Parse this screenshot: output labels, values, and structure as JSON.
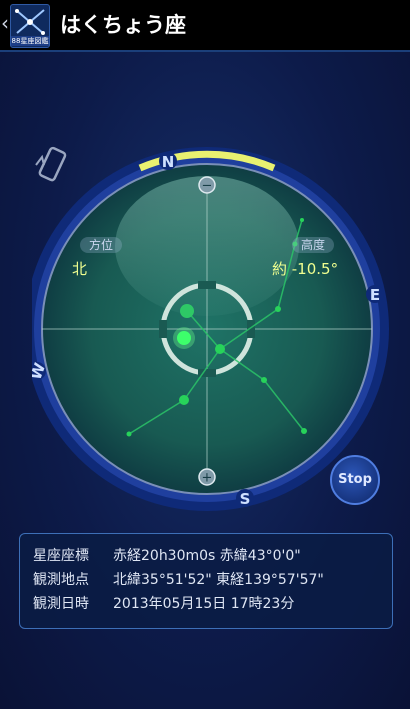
{
  "header": {
    "back_glyph": "‹",
    "logo_text": "88星座図鑑",
    "title": "はくちょう座"
  },
  "compass": {
    "directions": {
      "north": "N",
      "east": "E",
      "south": "S",
      "west": "W"
    },
    "azimuth_label": "方位",
    "azimuth_value": "北",
    "altitude_label": "高度",
    "altitude_value": "約 -10.5°",
    "zoom_out_glyph": "−",
    "zoom_in_glyph": "+"
  },
  "stop_button": {
    "label": "Stop"
  },
  "info": {
    "rows": [
      {
        "label": "星座座標",
        "value": "赤経20h30m0s 赤緯43°0'0\""
      },
      {
        "label": "観測地点",
        "value": "北緯35°51'52\" 東経139°57'57\""
      },
      {
        "label": "観測日時",
        "value": "2013年05月15日 17時23分"
      }
    ]
  },
  "colors": {
    "background": "#0a1236",
    "ring_blue": "#1f3f9e",
    "radar_green": "#1a5a52",
    "star_green": "#27d35a",
    "value_yellow": "#f0ff90",
    "highlight_yellow": "#e8f070"
  },
  "icons": {
    "back": "chevron-left-icon",
    "rotate": "rotate-device-icon",
    "zoom_out": "minus-icon",
    "zoom_in": "plus-icon"
  }
}
